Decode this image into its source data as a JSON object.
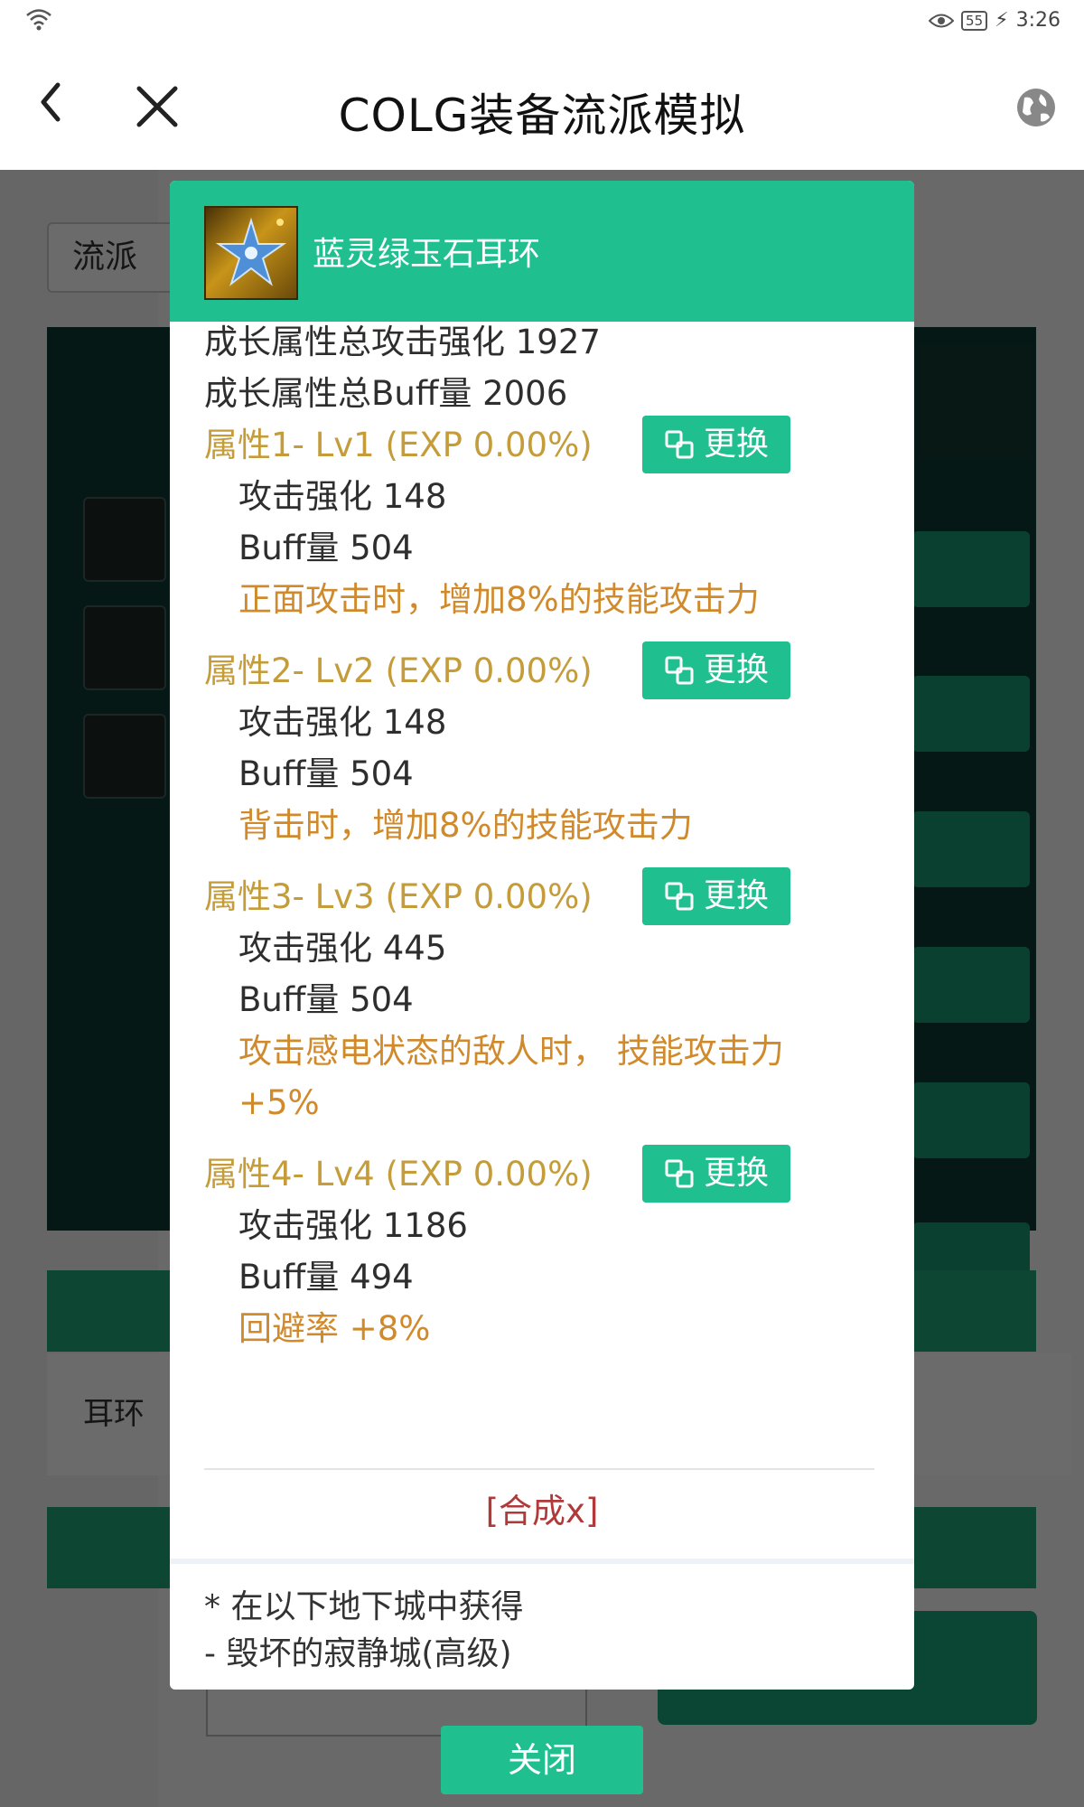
{
  "status_bar": {
    "battery": "55",
    "time": "3:26"
  },
  "header": {
    "title": "COLG装备流派模拟"
  },
  "background": {
    "input_text": "流派",
    "white_row_text": "耳环"
  },
  "item": {
    "name": "蓝灵绿玉石耳环",
    "growth_attack": "成长属性总攻击强化 1927",
    "growth_buff": "成长属性总Buff量 2006",
    "attributes": [
      {
        "title": "属性1- Lv1 (EXP 0.00%)",
        "attack": "攻击强化 148",
        "buff": "Buff量 504",
        "effect": "正面攻击时，增加8%的技能攻击力",
        "swap_label": "更换"
      },
      {
        "title": "属性2- Lv2 (EXP 0.00%)",
        "attack": "攻击强化 148",
        "buff": "Buff量 504",
        "effect": "背击时，增加8%的技能攻击力",
        "swap_label": "更换"
      },
      {
        "title": "属性3- Lv3 (EXP 0.00%)",
        "attack": "攻击强化 445",
        "buff": "Buff量 504",
        "effect": "攻击感电状态的敌人时， 技能攻击力 +5%",
        "swap_label": "更换"
      },
      {
        "title": "属性4- Lv4 (EXP 0.00%)",
        "attack": "攻击强化 1186",
        "buff": "Buff量 494",
        "effect": "回避率 +8%",
        "swap_label": "更换"
      }
    ],
    "synth_link": "[合成x]",
    "obtain_title": "* 在以下地下城中获得",
    "obtain_dungeon": "- 毁坏的寂静城(高级)"
  },
  "close_label": "关闭",
  "colors": {
    "accent": "#1fbf8f",
    "gold_text": "#c59c3a",
    "orange_text": "#d08a2c",
    "link_red": "#b03a3a"
  }
}
